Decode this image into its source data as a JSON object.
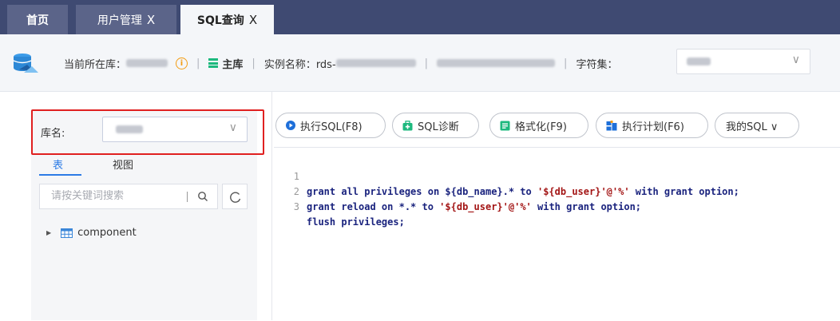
{
  "tabs": [
    {
      "label": "首页",
      "closable": false,
      "active": false
    },
    {
      "label": "用户管理",
      "closable": true,
      "active": false
    },
    {
      "label": "SQL查询",
      "closable": true,
      "active": true
    }
  ],
  "tab_close_glyph": "X",
  "infobar": {
    "current_db_label": "当前所在库：",
    "master_label": "主库",
    "instance_label": "实例名称：rds-",
    "charset_label": "字符集：",
    "separator": "|"
  },
  "left_panel": {
    "db_label": "库名:",
    "subtabs": [
      "表",
      "视图"
    ],
    "search_placeholder": "请按关键词搜索",
    "tree": [
      {
        "label": "component"
      }
    ]
  },
  "toolbar": {
    "execute": "执行SQL(F8)",
    "diagnose": "SQL诊断",
    "format": "格式化(F9)",
    "plan": "执行计划(F6)",
    "my_sql": "我的SQL ∨"
  },
  "editor": {
    "lines": [
      {
        "n": "1",
        "pre": "grant all privileges on ${db_name}.* to ",
        "str": "'${db_user}'@'%'",
        "post": " with grant option;"
      },
      {
        "n": "2",
        "pre": "grant reload on *.* to ",
        "str": "'${db_user}'@'%'",
        "post": " with grant option;"
      },
      {
        "n": "3",
        "pre": "flush privileges;",
        "str": "",
        "post": ""
      }
    ]
  },
  "colors": {
    "tabbar_bg": "#3f4a72",
    "accent_blue": "#2c7be5",
    "highlight_red": "#e02020",
    "master_green": "#1db97e",
    "warning_orange": "#f39c12"
  }
}
